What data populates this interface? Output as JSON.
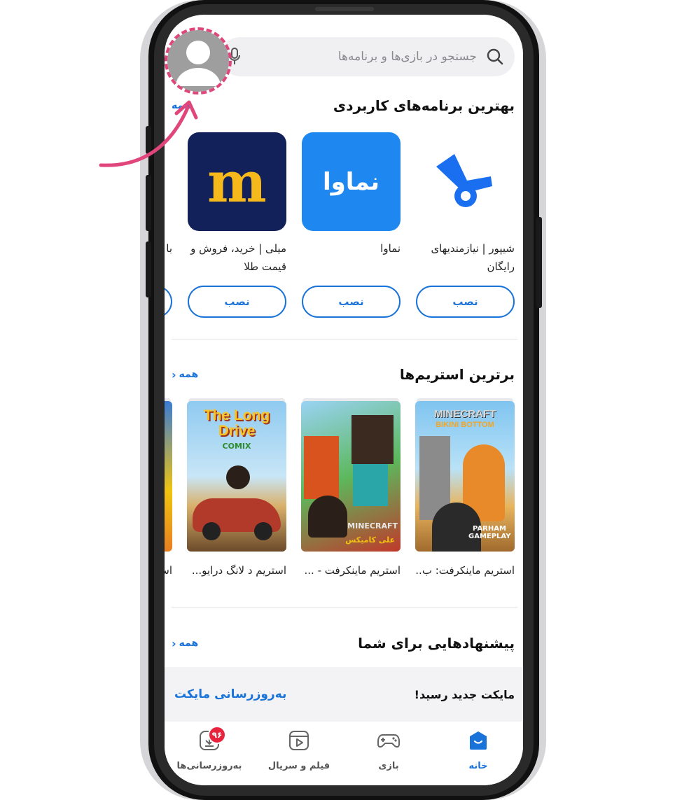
{
  "search": {
    "placeholder": "جستجو در بازی‌ها و برنامه‌ها"
  },
  "sections": {
    "apps": {
      "title": "بهترین برنامه‌های کاربردی",
      "see_all": "همه",
      "install_label": "نصب",
      "items": [
        {
          "name": "شیپور | نیازمندیهای رایگان",
          "icon": "sheypoor-horn-icon",
          "color": "#ffffff"
        },
        {
          "name": "نماوا",
          "icon": "namava-logo-icon",
          "icon_text": "نماوا",
          "color": "#1e88f0"
        },
        {
          "name": "میلی | خرید، فروش و قیمت طلا",
          "icon": "milli-logo-icon",
          "icon_text": "m",
          "color": "#13215a"
        },
        {
          "name": "با ها",
          "icon": "partial-app-icon",
          "color": "#ffffff"
        }
      ]
    },
    "streams": {
      "title": "برترین استریم‌ها",
      "see_all": "همه",
      "items": [
        {
          "name": "استریم ماینکرفت: ب..",
          "thumb_text_top": "MINECRAFT",
          "thumb_text_sub": "BIKINI BOTTOM",
          "thumb_caption": "PARHAM GAMEPLAY"
        },
        {
          "name": "استریم ماینکرفت - ...",
          "thumb_text_top": "MINECRAFT",
          "thumb_caption": "علی کامیکس"
        },
        {
          "name": "استریم د لانگ درایو...",
          "thumb_text_top": "The Long Drive",
          "thumb_text_sub": "COMIX"
        },
        {
          "name": "اس"
        }
      ]
    },
    "suggestions": {
      "title": "پیشنهادهایی برای شما",
      "see_all": "همه",
      "message": "مایکت جدید رسید!",
      "link": "به‌روزرسانی مایکت"
    }
  },
  "bottom_nav": [
    {
      "label": "خانه",
      "icon": "home-icon",
      "active": true
    },
    {
      "label": "بازی",
      "icon": "gamepad-icon",
      "active": false
    },
    {
      "label": "فیلم و سریال",
      "icon": "video-icon",
      "active": false
    },
    {
      "label": "به‌روزرسانی‌ها",
      "icon": "download-icon",
      "active": false,
      "badge": "۹۶"
    }
  ],
  "colors": {
    "accent": "#1a73d9",
    "badge": "#e8233e",
    "highlight": "#e0457b"
  }
}
